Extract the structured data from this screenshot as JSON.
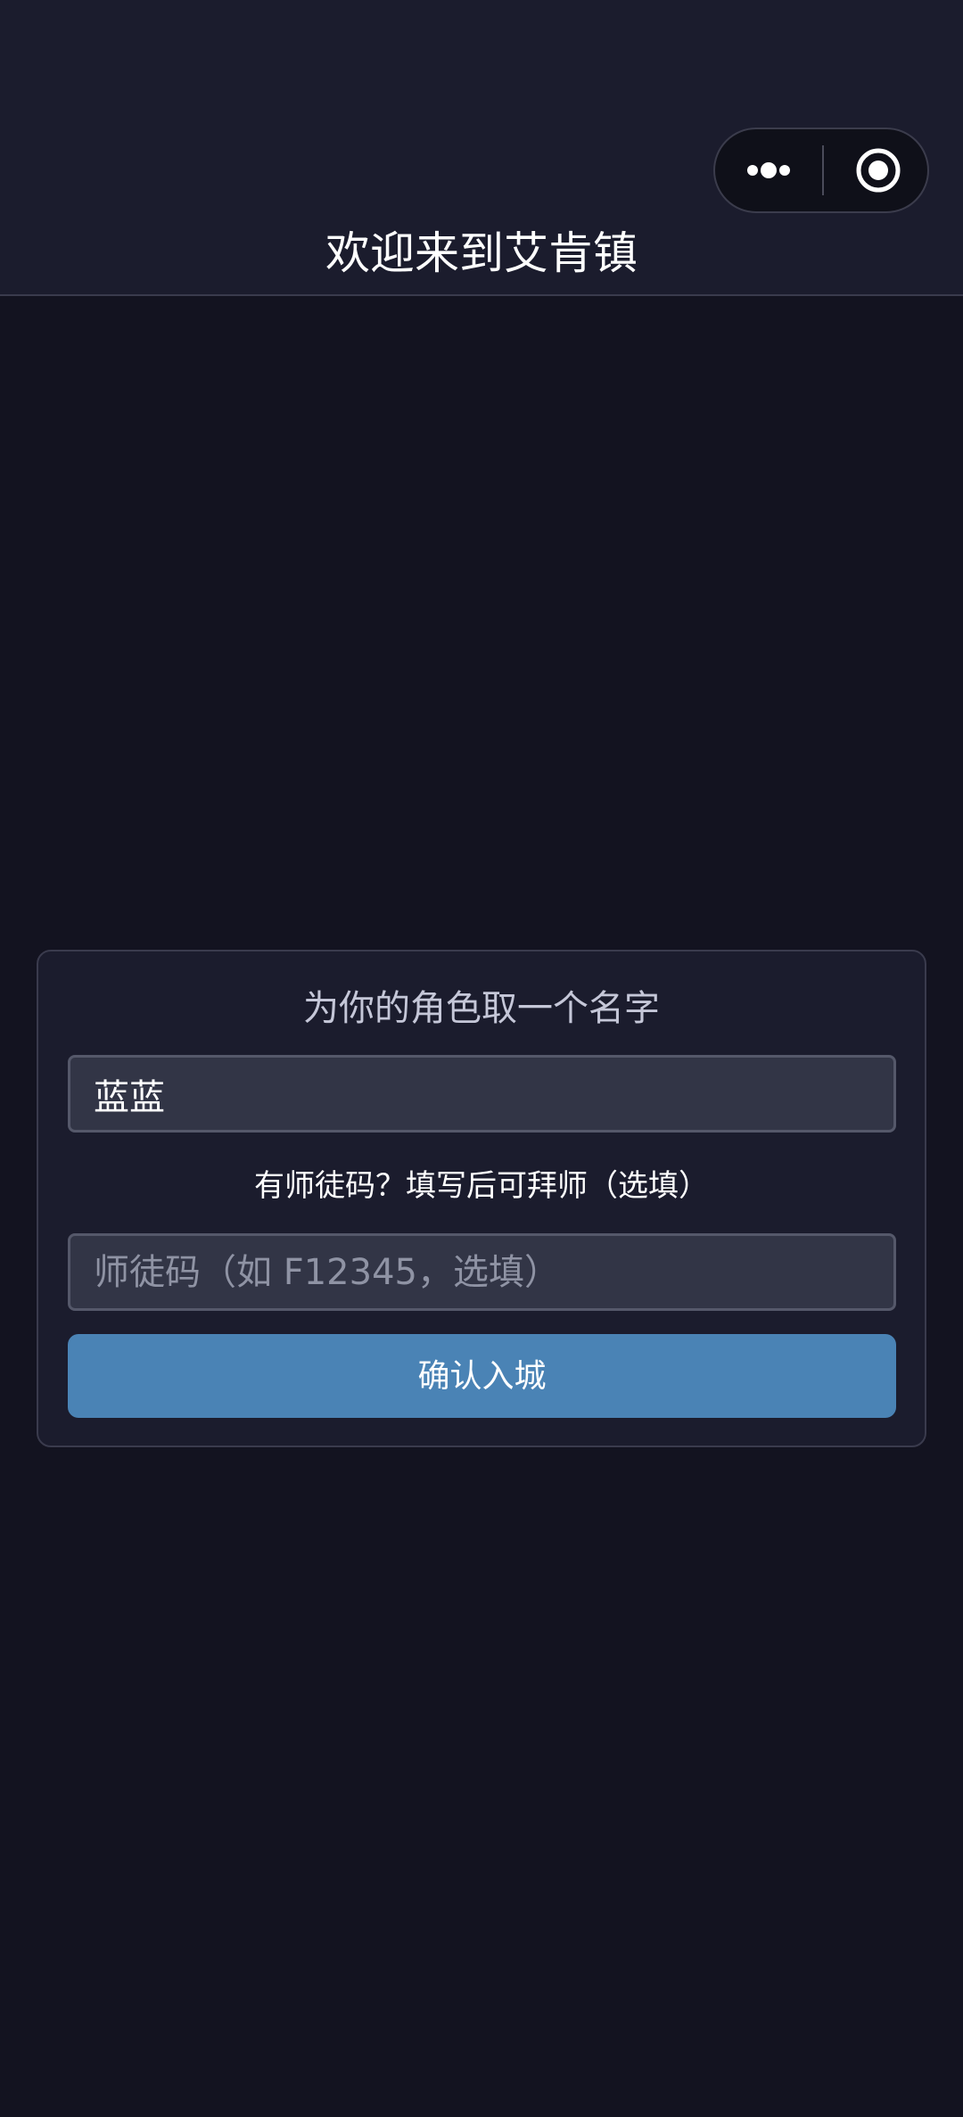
{
  "header": {
    "title": "欢迎来到艾肯镇",
    "capsule": {
      "more_icon": "more-dots-icon",
      "close_icon": "target-circle-icon"
    }
  },
  "form": {
    "name_prompt": "为你的角色取一个名字",
    "name_value": "蓝蓝",
    "mentor_hint": "有师徒码？填写后可拜师（选填）",
    "mentor_code_placeholder": "师徒码（如 F12345，选填）",
    "mentor_code_value": "",
    "confirm_label": "确认入城"
  },
  "colors": {
    "page_bg": "#131320",
    "header_bg": "#1b1c2d",
    "card_bg": "#1b1c2d",
    "input_bg": "#323546",
    "accent": "#4a83b5"
  }
}
